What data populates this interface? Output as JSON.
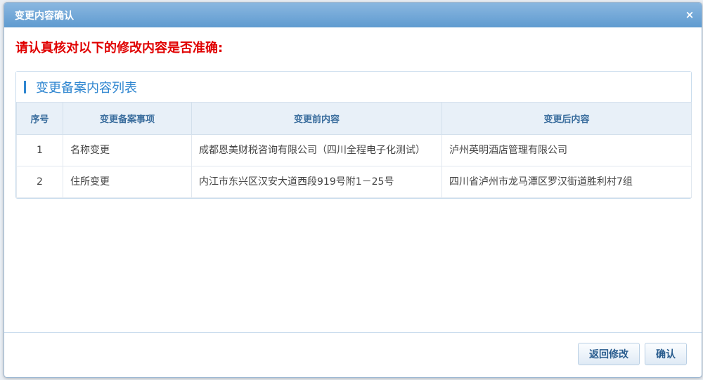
{
  "dialog": {
    "title": "变更内容确认",
    "close_symbol": "×",
    "warning": "请认真核对以下的修改内容是否准确:"
  },
  "panel": {
    "title": "变更备案内容列表"
  },
  "table": {
    "headers": [
      "序号",
      "变更备案事项",
      "变更前内容",
      "变更后内容"
    ],
    "rows": [
      {
        "seq": "1",
        "item": "名称变更",
        "before": "成都恩美财税咨询有限公司（四川全程电子化测试）",
        "after": "泸州英明酒店管理有限公司"
      },
      {
        "seq": "2",
        "item": "住所变更",
        "before": "内江市东兴区汉安大道西段919号附1－25号",
        "after": "四川省泸州市龙马潭区罗汉街道胜利村7组"
      }
    ]
  },
  "buttons": {
    "back": "返回修改",
    "confirm": "确认"
  },
  "colors": {
    "title_bar": "#6fa7d8",
    "warning": "#e00000",
    "accent": "#2f86d0"
  }
}
